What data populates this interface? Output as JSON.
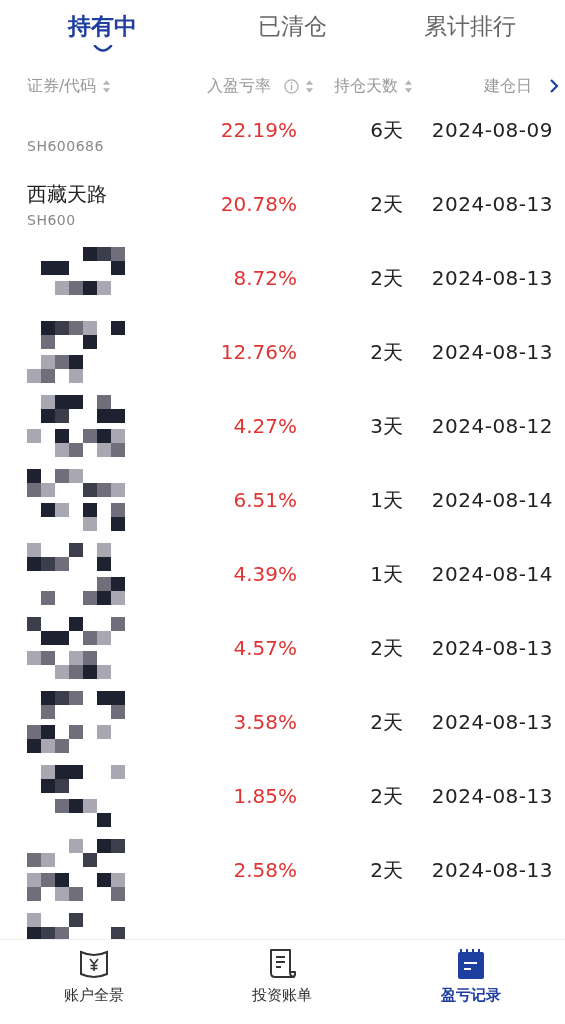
{
  "tabs": [
    {
      "label": "持有中",
      "selected": true
    },
    {
      "label": "已清仓",
      "selected": false
    },
    {
      "label": "累计排行",
      "selected": false
    }
  ],
  "columns": [
    {
      "label": "证券/代码",
      "sortable": true,
      "info": false
    },
    {
      "label": "入盈亏率",
      "sortable": true,
      "info": true
    },
    {
      "label": "持仓天数",
      "sortable": true,
      "info": false
    },
    {
      "label": "建仓日",
      "sortable": false,
      "info": false
    }
  ],
  "rows": [
    {
      "kind": "named",
      "code": "SH600686",
      "rate": "22.19%",
      "days": "6天",
      "date": "2024-08-09"
    },
    {
      "kind": "named",
      "name": "西藏天路",
      "code": "SH600",
      "rate": "20.78%",
      "days": "2天",
      "date": "2024-08-13"
    },
    {
      "kind": "masked",
      "rate": "8.72%",
      "days": "2天",
      "date": "2024-08-13"
    },
    {
      "kind": "masked",
      "rate": "12.76%",
      "days": "2天",
      "date": "2024-08-13"
    },
    {
      "kind": "masked",
      "rate": "4.27%",
      "days": "3天",
      "date": "2024-08-12"
    },
    {
      "kind": "masked",
      "rate": "6.51%",
      "days": "1天",
      "date": "2024-08-14"
    },
    {
      "kind": "masked",
      "rate": "4.39%",
      "days": "1天",
      "date": "2024-08-14"
    },
    {
      "kind": "masked",
      "rate": "4.57%",
      "days": "2天",
      "date": "2024-08-13"
    },
    {
      "kind": "masked",
      "rate": "3.58%",
      "days": "2天",
      "date": "2024-08-13"
    },
    {
      "kind": "masked",
      "rate": "1.85%",
      "days": "2天",
      "date": "2024-08-13"
    },
    {
      "kind": "masked",
      "rate": "2.58%",
      "days": "2天",
      "date": "2024-08-13"
    },
    {
      "kind": "masked"
    }
  ],
  "nav": [
    {
      "label": "账户全景",
      "kind": "wallet",
      "selected": false
    },
    {
      "label": "投资账单",
      "kind": "bill",
      "selected": false
    },
    {
      "label": "盈亏记录",
      "kind": "calendar",
      "selected": true
    }
  ]
}
